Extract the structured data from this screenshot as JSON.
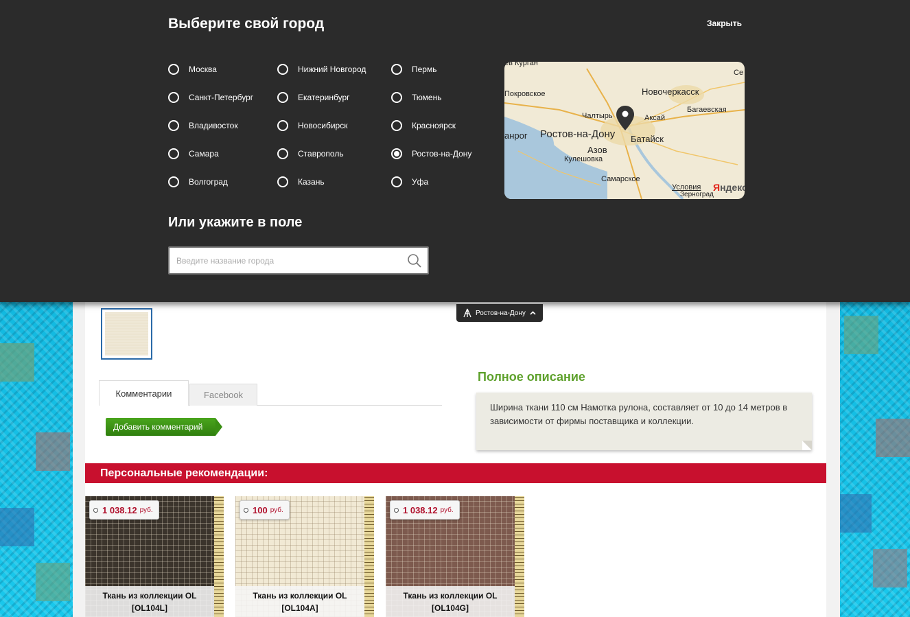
{
  "modal": {
    "title": "Выберите свой город",
    "close_label": "Закрыть",
    "cities": [
      {
        "name": "Москва",
        "selected": false
      },
      {
        "name": "Санкт-Петербург",
        "selected": false
      },
      {
        "name": "Владивосток",
        "selected": false
      },
      {
        "name": "Самара",
        "selected": false
      },
      {
        "name": "Волгоград",
        "selected": false
      },
      {
        "name": "Нижний Новгород",
        "selected": false
      },
      {
        "name": "Екатеринбург",
        "selected": false
      },
      {
        "name": "Новосибирск",
        "selected": false
      },
      {
        "name": "Ставрополь",
        "selected": false
      },
      {
        "name": "Казань",
        "selected": false
      },
      {
        "name": "Пермь",
        "selected": false
      },
      {
        "name": "Тюмень",
        "selected": false
      },
      {
        "name": "Красноярск",
        "selected": false
      },
      {
        "name": "Ростов-на-Дону",
        "selected": true
      },
      {
        "name": "Уфа",
        "selected": false
      }
    ],
    "subtitle": "Или укажите в поле",
    "search_placeholder": "Введите название города",
    "map": {
      "labels": [
        "ев Курган",
        "Се",
        "Покровское",
        "Новочеркасск",
        "Чалтырь",
        "Багаевская",
        "Аксай",
        "анрог",
        "Ростов-на-Дону",
        "Батайск",
        "Азов",
        "Кулешовка",
        "Самарское",
        "Условия",
        "Зерноград"
      ],
      "brand_first": "Я",
      "brand_rest": "ндекс"
    }
  },
  "city_selector": {
    "label": "Ростов-на-Дону"
  },
  "tabs": [
    "Комментарии",
    "Facebook"
  ],
  "add_comment_label": "Добавить комментарий",
  "description": {
    "title": "Полное описание",
    "text": "Ширина ткани 110 см Намотка рулона, составляет от 10 до 14 метров в зависимости от фирмы поставщика и коллекции."
  },
  "recommendations": {
    "title": "Персональные рекомендации:",
    "products": [
      {
        "price": "1 038.12",
        "currency": "руб.",
        "name_line1": "Ткань из коллекции OL",
        "name_line2": "[OL104L]",
        "fabric_color": "#3b342c"
      },
      {
        "price": "100",
        "currency": "руб.",
        "name_line1": "Ткань из коллекции OL",
        "name_line2": "[OL104A]",
        "fabric_color": "#f1e9d4"
      },
      {
        "price": "1 038.12",
        "currency": "руб.",
        "name_line1": "Ткань из коллекции OL",
        "name_line2": "[OL104G]",
        "fabric_color": "#7d5a4e"
      }
    ]
  },
  "colors": {
    "overlay_bg": "#2b2b2b",
    "accent_green": "#5ea12c",
    "reco_red": "#c8102e",
    "price_red": "#b0102c"
  }
}
